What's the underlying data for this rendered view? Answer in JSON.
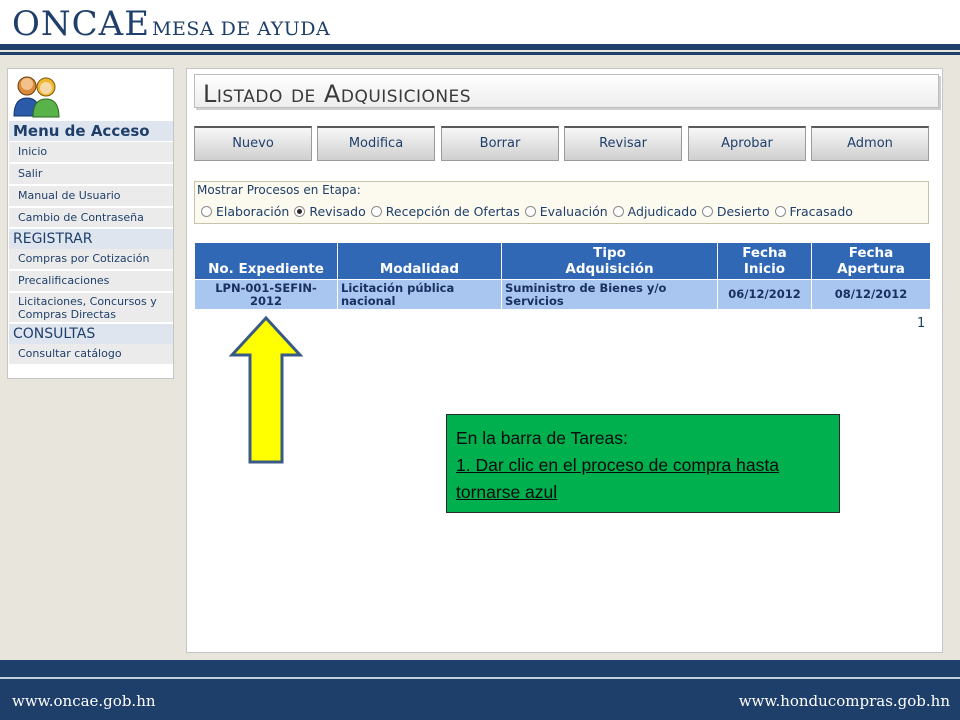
{
  "header": {
    "logo_main": "ONCAE",
    "logo_sub": "MESA DE AYUDA"
  },
  "footer": {
    "left_url": "www.oncae.gob.hn",
    "right_url": "www.honducompras.gob.hn"
  },
  "sidebar": {
    "menu_title": "Menu de Acceso",
    "menu_items": [
      {
        "label": "Inicio"
      },
      {
        "label": "Salir"
      },
      {
        "label": "Manual de Usuario"
      },
      {
        "label": "Cambio de Contraseña"
      }
    ],
    "registrar_title": "REGISTRAR",
    "registrar_items": [
      {
        "label": "Compras por Cotización"
      },
      {
        "label": "Precalificaciones"
      },
      {
        "label_line1": "Licitaciones, Concursos y",
        "label_line2": "Compras Directas"
      }
    ],
    "consultas_title": "CONSULTAS",
    "consultas_items": [
      {
        "label": "Consultar catálogo"
      }
    ]
  },
  "main": {
    "title": "Listado de Adquisiciones",
    "toolbar": [
      {
        "label": "Nuevo"
      },
      {
        "label": "Modifica"
      },
      {
        "label": "Borrar"
      },
      {
        "label": "Revisar"
      },
      {
        "label": "Aprobar"
      },
      {
        "label": "Admon"
      }
    ],
    "filter": {
      "label": "Mostrar Procesos en Etapa:",
      "selected": "Revisado",
      "options": [
        {
          "label": "Elaboración",
          "checked": false
        },
        {
          "label": "Revisado",
          "checked": true
        },
        {
          "label": "Recepción de Ofertas",
          "checked": false
        },
        {
          "label": "Evaluación",
          "checked": false
        },
        {
          "label": "Adjudicado",
          "checked": false
        },
        {
          "label": "Desierto",
          "checked": false
        },
        {
          "label": "Fracasado",
          "checked": false
        }
      ]
    },
    "table": {
      "headers": [
        {
          "line1": "",
          "line2": "No. Expediente"
        },
        {
          "line1": "",
          "line2": "Modalidad"
        },
        {
          "line1": "Tipo",
          "line2": "Adquisición"
        },
        {
          "line1": "Fecha",
          "line2": "Inicio"
        },
        {
          "line1": "Fecha",
          "line2": "Apertura"
        }
      ],
      "rows": [
        {
          "expediente_line1": "LPN-001-SEFIN-",
          "expediente_line2": "2012",
          "modalidad_line1": "Licitación pública",
          "modalidad_line2": "nacional",
          "tipo_line1": "Suministro de Bienes y/o",
          "tipo_line2": "Servicios",
          "fecha_inicio": "06/12/2012",
          "fecha_apertura": "08/12/2012"
        }
      ]
    },
    "pagination": "1"
  },
  "annotation": {
    "arrow_icon": "up-arrow-icon",
    "arrow_color": "#ffff00",
    "callout_color": "#00b04f",
    "callout_line1": "En la barra de Tareas:",
    "callout_line2a": "1. Dar clic en el proceso de compra hasta",
    "callout_line2b": "tornarse azul"
  }
}
